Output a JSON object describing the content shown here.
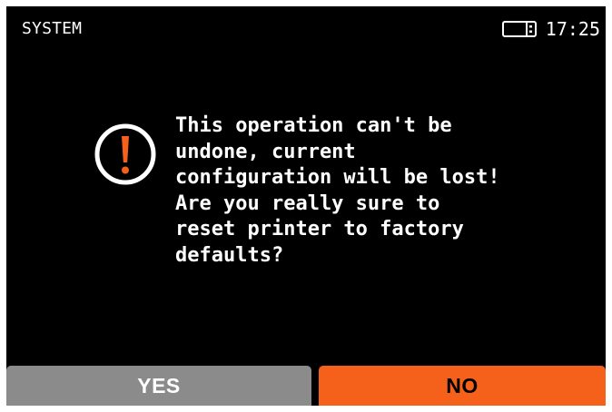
{
  "header": {
    "title": "SYSTEM",
    "time": "17:25",
    "status_icon": "usb-drive-icon"
  },
  "dialog": {
    "icon": "warning-icon",
    "message": "This operation can't be\nundone, current\nconfiguration will be lost!\nAre you really sure to\nreset printer to factory\ndefaults?"
  },
  "buttons": {
    "yes_label": "YES",
    "no_label": "NO"
  },
  "colors": {
    "background": "#000000",
    "accent": "#f5611a",
    "yes_button": "#8b8b8b",
    "text": "#ffffff"
  }
}
